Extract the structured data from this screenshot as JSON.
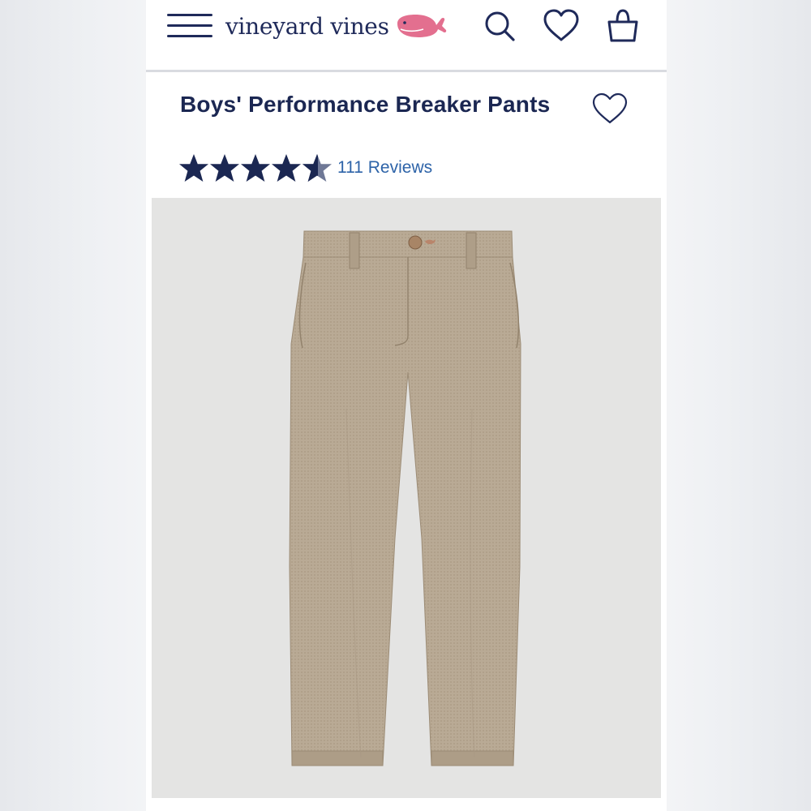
{
  "header": {
    "brand": "vineyard vines",
    "icons": [
      "menu-icon",
      "whale-logo-icon",
      "search-icon",
      "heart-icon",
      "bag-icon"
    ]
  },
  "product": {
    "title": "Boys' Performance Breaker Pants",
    "rating": 4.5,
    "max_rating": 5,
    "reviews_label": "111 Reviews"
  },
  "colors": {
    "navy": "#1b2752",
    "link": "#2d63a8",
    "whale_pink": "#e36f8f",
    "pants_khaki": "#b8a892",
    "photo_bg": "#e4e4e3"
  }
}
